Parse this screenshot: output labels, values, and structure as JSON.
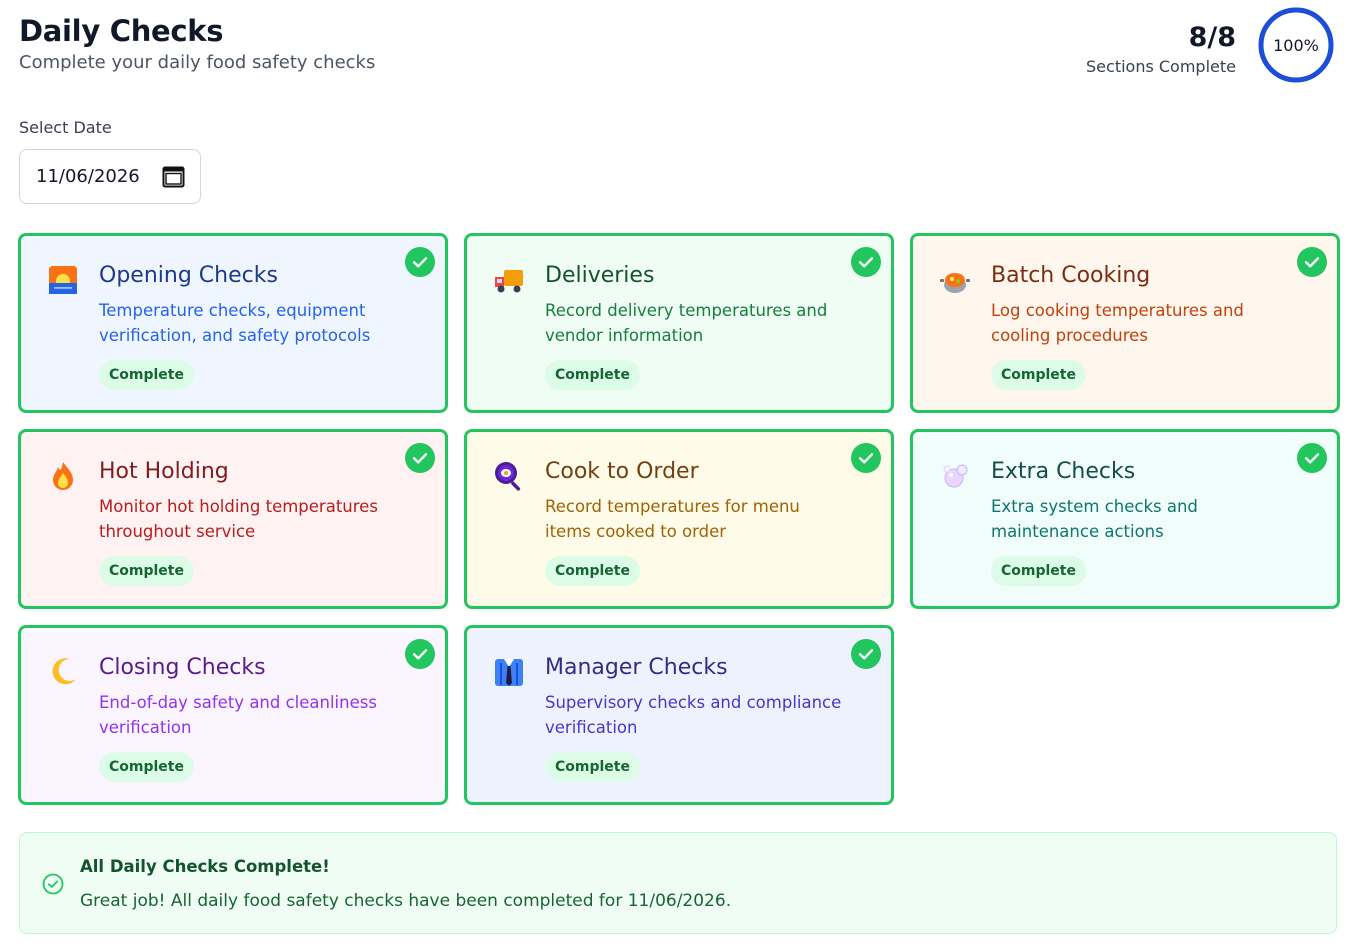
{
  "header": {
    "title": "Daily Checks",
    "subtitle": "Complete your daily food safety checks"
  },
  "progress": {
    "count": "8/8",
    "label": "Sections Complete",
    "percent_text": "100%",
    "fraction": 1.0,
    "ring_color": "#1d4ed8"
  },
  "date": {
    "label": "Select Date",
    "value": "11/06/2026"
  },
  "cards": [
    {
      "title": "Opening Checks",
      "desc": "Temperature checks, equipment verification, and safety protocols",
      "badge": "Complete",
      "icon": "sunrise-icon",
      "bg": "#eff6ff",
      "title_color": "#1e3a8a",
      "desc_color": "#2563eb"
    },
    {
      "title": "Deliveries",
      "desc": "Record delivery temperatures and vendor information",
      "badge": "Complete",
      "icon": "delivery-truck-icon",
      "bg": "#f0fdf4",
      "title_color": "#14532d",
      "desc_color": "#15803d"
    },
    {
      "title": "Batch Cooking",
      "desc": "Log cooking temperatures and cooling procedures",
      "badge": "Complete",
      "icon": "cooking-pot-icon",
      "bg": "#fff7ed",
      "title_color": "#7c2d12",
      "desc_color": "#c2410c"
    },
    {
      "title": "Hot Holding",
      "desc": "Monitor hot holding temperatures throughout service",
      "badge": "Complete",
      "icon": "fire-icon",
      "bg": "#fef2f2",
      "title_color": "#7f1d1d",
      "desc_color": "#b91c1c"
    },
    {
      "title": "Cook to Order",
      "desc": "Record temperatures for menu items cooked to order",
      "badge": "Complete",
      "icon": "frying-pan-icon",
      "bg": "#fefce8",
      "title_color": "#713f12",
      "desc_color": "#a16207"
    },
    {
      "title": "Extra Checks",
      "desc": "Extra system checks and maintenance actions",
      "badge": "Complete",
      "icon": "soap-bubbles-icon",
      "bg": "#f0fdfa",
      "title_color": "#134e4a",
      "desc_color": "#0f766e"
    },
    {
      "title": "Closing Checks",
      "desc": "End-of-day safety and cleanliness verification",
      "badge": "Complete",
      "icon": "crescent-moon-icon",
      "bg": "#faf5ff",
      "title_color": "#581c87",
      "desc_color": "#9333ea"
    },
    {
      "title": "Manager Checks",
      "desc": "Supervisory checks and compliance verification",
      "badge": "Complete",
      "icon": "manager-suit-icon",
      "bg": "#eef2ff",
      "title_color": "#312e81",
      "desc_color": "#4338ca"
    }
  ],
  "banner": {
    "title": "All Daily Checks Complete!",
    "text": "Great job! All daily food safety checks have been completed for 11/06/2026."
  },
  "colors": {
    "complete_green": "#22c55e",
    "badge_bg": "#dcfce7",
    "badge_text": "#166534"
  }
}
